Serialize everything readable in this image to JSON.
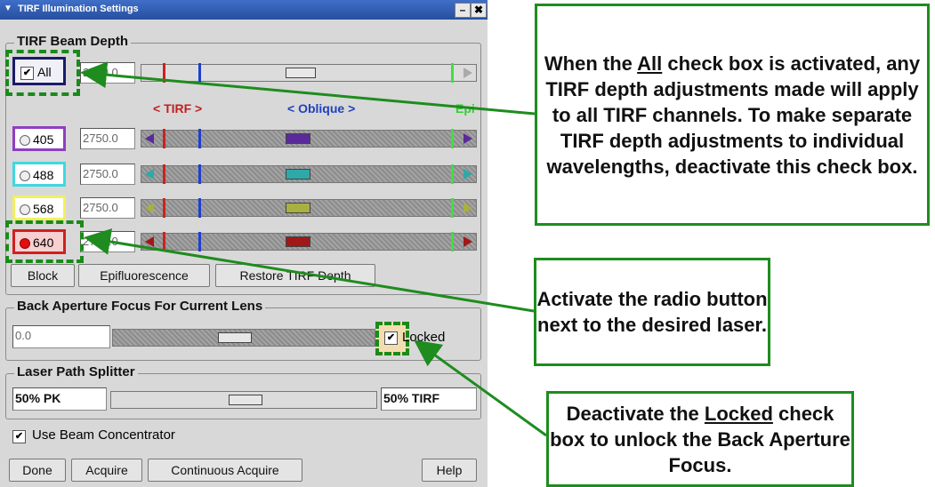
{
  "window": {
    "title": "TIRF Illumination Settings",
    "minimize": "–",
    "close": "✖"
  },
  "beam_depth": {
    "legend": "TIRF Beam Depth",
    "all_label": "All",
    "all_checked": true,
    "all_value": "2750.0",
    "tirf_label": "< TIRF >",
    "oblique_label": "< Oblique >",
    "epi_label": "Epi",
    "rows": [
      {
        "label": "405",
        "value": "2750.0",
        "color": "#8e3fc0",
        "thumb": "#5a2a9a"
      },
      {
        "label": "488",
        "value": "2750.0",
        "color": "#40d8e0",
        "thumb": "#2fa8a8"
      },
      {
        "label": "568",
        "value": "2750.0",
        "color": "#f0f060",
        "thumb": "#a8b040"
      },
      {
        "label": "640",
        "value": "2750.0",
        "color": "#d02020",
        "thumb": "#a01818"
      }
    ],
    "selected_row": "640",
    "buttons": [
      "Block",
      "Epifluorescence",
      "Restore TIRF Depth"
    ]
  },
  "back_aperture": {
    "legend": "Back Aperture Focus For Current Lens",
    "value": "0.0",
    "locked_label": "Locked",
    "locked_checked": true
  },
  "splitter": {
    "legend": "Laser Path Splitter",
    "left_label": "50% PK",
    "right_label": "50% TIRF",
    "position": 0.5
  },
  "beam_concentrator": {
    "label": "Use Beam Concentrator",
    "checked": true
  },
  "footer_buttons": {
    "done": "Done",
    "acquire": "Acquire",
    "continuous": "Continuous Acquire",
    "help": "Help"
  },
  "callouts": {
    "all": {
      "pre": "When the ",
      "u": "All",
      "post": " check box is activated, any TIRF depth adjustments made will apply to all TIRF channels. To make separate TIRF depth adjustments to individual wavelengths, deactivate this check box."
    },
    "radio": {
      "text": "Activate the radio button next to the desired laser."
    },
    "locked": {
      "pre": "Deactivate the ",
      "u": "Locked",
      "post": " check box to unlock the Back Aperture Focus."
    }
  },
  "colors": {
    "callout_border": "#1e8c1e",
    "tirf_marker": "#d02020",
    "oblique_marker": "#1f3fd0",
    "epi_marker": "#3fe03f"
  }
}
